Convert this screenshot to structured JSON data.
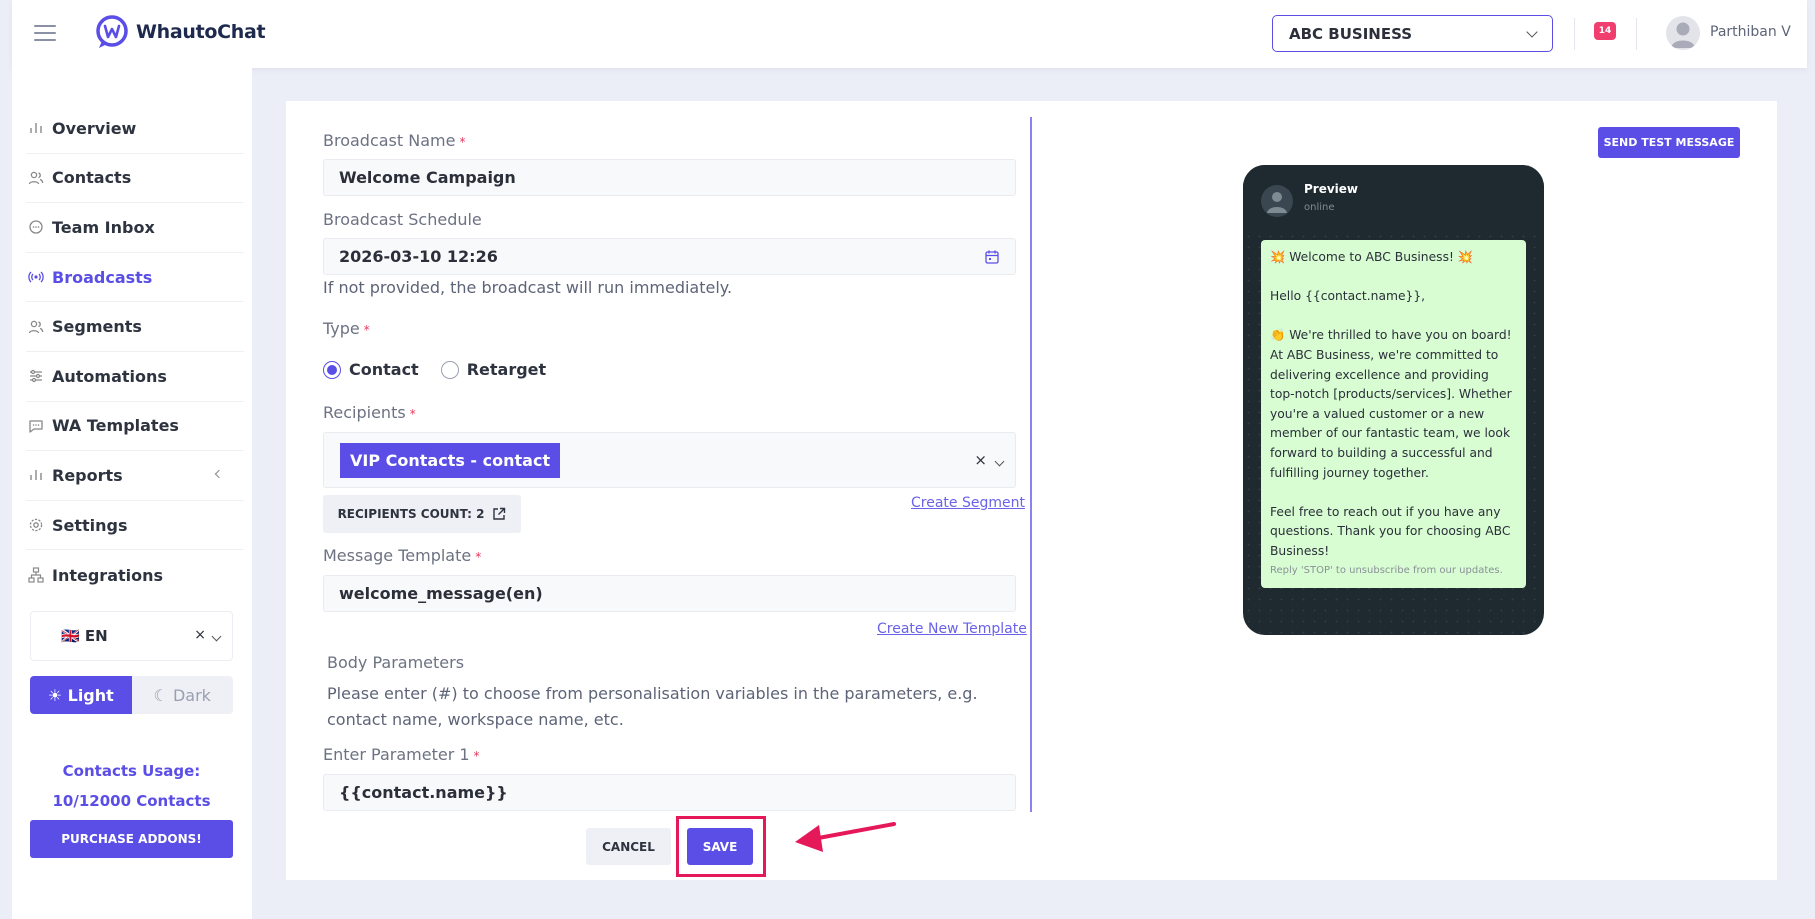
{
  "header": {
    "brand": "WhautoChat",
    "business": "ABC BUSINESS",
    "notification_count": "14",
    "user_name": "Parthiban V"
  },
  "sidebar": {
    "items": [
      {
        "label": "Overview",
        "icon": "bar-chart-icon"
      },
      {
        "label": "Contacts",
        "icon": "users-icon"
      },
      {
        "label": "Team Inbox",
        "icon": "chat-bubble-icon"
      },
      {
        "label": "Broadcasts",
        "icon": "broadcast-icon",
        "active": true
      },
      {
        "label": "Segments",
        "icon": "users-icon"
      },
      {
        "label": "Automations",
        "icon": "sliders-icon"
      },
      {
        "label": "WA Templates",
        "icon": "message-square-icon"
      },
      {
        "label": "Reports",
        "icon": "bar-chart-icon"
      },
      {
        "label": "Settings",
        "icon": "gear-icon"
      },
      {
        "label": "Integrations",
        "icon": "network-icon"
      }
    ],
    "language": "🇬🇧 EN",
    "language_clear": "×",
    "theme_light": "☀ Light",
    "theme_dark": "☾ Dark",
    "usage_title": "Contacts Usage:",
    "usage_value": "10/12000 Contacts",
    "purchase_label": "PURCHASE ADDONS!"
  },
  "form": {
    "broadcast_name_label": "Broadcast Name",
    "broadcast_name_value": "Welcome Campaign",
    "schedule_label": "Broadcast Schedule",
    "schedule_value": "2026-03-10 12:26",
    "schedule_hint": "If not provided, the broadcast will run immediately.",
    "type_label": "Type",
    "type_options": [
      "Contact",
      "Retarget"
    ],
    "type_selected": "Contact",
    "recipients_label": "Recipients",
    "recipients_chip": "VIP Contacts - contact",
    "recipients_clear": "×",
    "recipients_count": "RECIPIENTS COUNT: 2",
    "create_segment": "Create Segment",
    "template_label": "Message Template",
    "template_value": "welcome_message(en)",
    "create_template": "Create New Template",
    "body_params_title": "Body Parameters",
    "body_params_hint": "Please enter (#) to choose from personalisation variables in the parameters, e.g. contact name, workspace name, etc.",
    "param1_label": "Enter Parameter 1",
    "param1_value": "{{contact.name}}",
    "cancel_label": "CANCEL",
    "save_label": "SAVE",
    "required_mark": "*"
  },
  "preview": {
    "send_test_label": "SEND TEST MESSAGE",
    "title": "Preview",
    "status": "online",
    "message_lines": [
      "💥 Welcome to ABC Business! 💥",
      "",
      "Hello {{contact.name}},",
      "",
      "👏 We're thrilled to have you on board! At ABC Business, we're committed to delivering excellence and providing top-notch [products/services]. Whether you're a valued customer or a new member of our fantastic team, we look forward to building a successful and fulfilling journey together.",
      "",
      "Feel free to reach out if you have any questions. Thank you for choosing ABC Business!"
    ],
    "footer": "Reply 'STOP' to unsubscribe from our updates."
  },
  "colors": {
    "accent": "#5a4ee6",
    "highlight": "#e5195a",
    "bubble": "#d8fdd2",
    "phone_bg": "#1f2a30"
  }
}
